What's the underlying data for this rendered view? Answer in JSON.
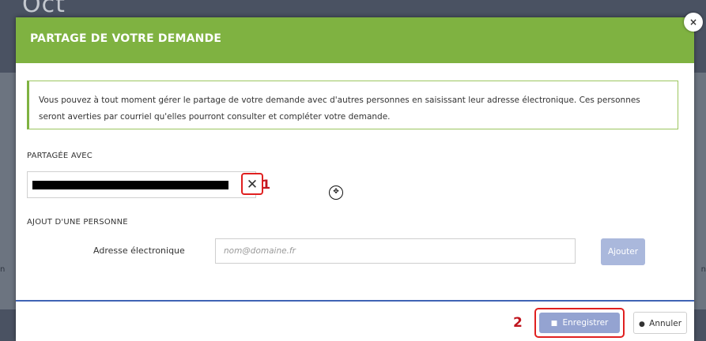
{
  "background": {
    "logo_text": "Oct",
    "left_edge_char": "n",
    "right_edge_char": "n"
  },
  "modal": {
    "title": "PARTAGE DE VOTRE DEMANDE",
    "close_icon": "×",
    "info_text": "Vous pouvez à tout moment gérer le partage de votre demande avec d'autres personnes en saisissant leur adresse électronique. Ces personnes seront averties par courriel qu'elles pourront consulter et compléter votre demande.",
    "shared_with": {
      "label": "PARTAGÉE AVEC",
      "remove_icon": "✕",
      "marker": "1"
    },
    "add_person": {
      "label": "AJOUT D'UNE PERSONNE",
      "email_label": "Adresse électronique",
      "email_placeholder": "nom@domaine.fr",
      "email_value": "",
      "add_button": "Ajouter"
    },
    "footer": {
      "marker": "2",
      "save_icon": "■",
      "save_button": "Enregistrer",
      "cancel_icon": "●",
      "cancel_button": "Annuler"
    },
    "move_icon": "✥"
  },
  "colors": {
    "header_green": "#7fb241",
    "highlight_red": "#e02020",
    "footer_blue": "#3f63b5",
    "button_blue": "#94a3d1"
  }
}
